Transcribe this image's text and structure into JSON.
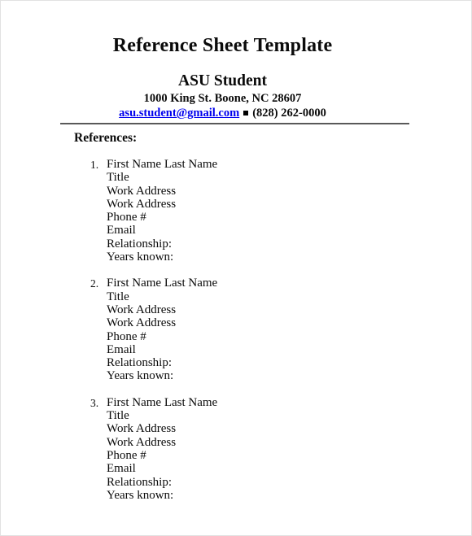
{
  "document": {
    "title": "Reference Sheet Template",
    "header": {
      "name": "ASU Student",
      "address": "1000 King St. Boone, NC 28607",
      "email": "asu.student@gmail.com",
      "separator": "■",
      "phone": "(828) 262-0000",
      "email_color": "#0000ee"
    },
    "section": {
      "heading": "References:"
    },
    "references": [
      {
        "number": "1.",
        "lines": [
          "First Name Last Name",
          "Title",
          "Work Address",
          "Work Address",
          "Phone #",
          "Email",
          "Relationship:",
          "Years known:"
        ]
      },
      {
        "number": "2.",
        "lines": [
          "First Name Last Name",
          "Title",
          "Work Address",
          "Work Address",
          "Phone #",
          "Email",
          "Relationship:",
          "Years known:"
        ]
      },
      {
        "number": "3.",
        "lines": [
          "First Name Last Name",
          "Title",
          "Work Address",
          "Work Address",
          "Phone #",
          "Email",
          "Relationship:",
          "Years known:"
        ]
      }
    ]
  }
}
